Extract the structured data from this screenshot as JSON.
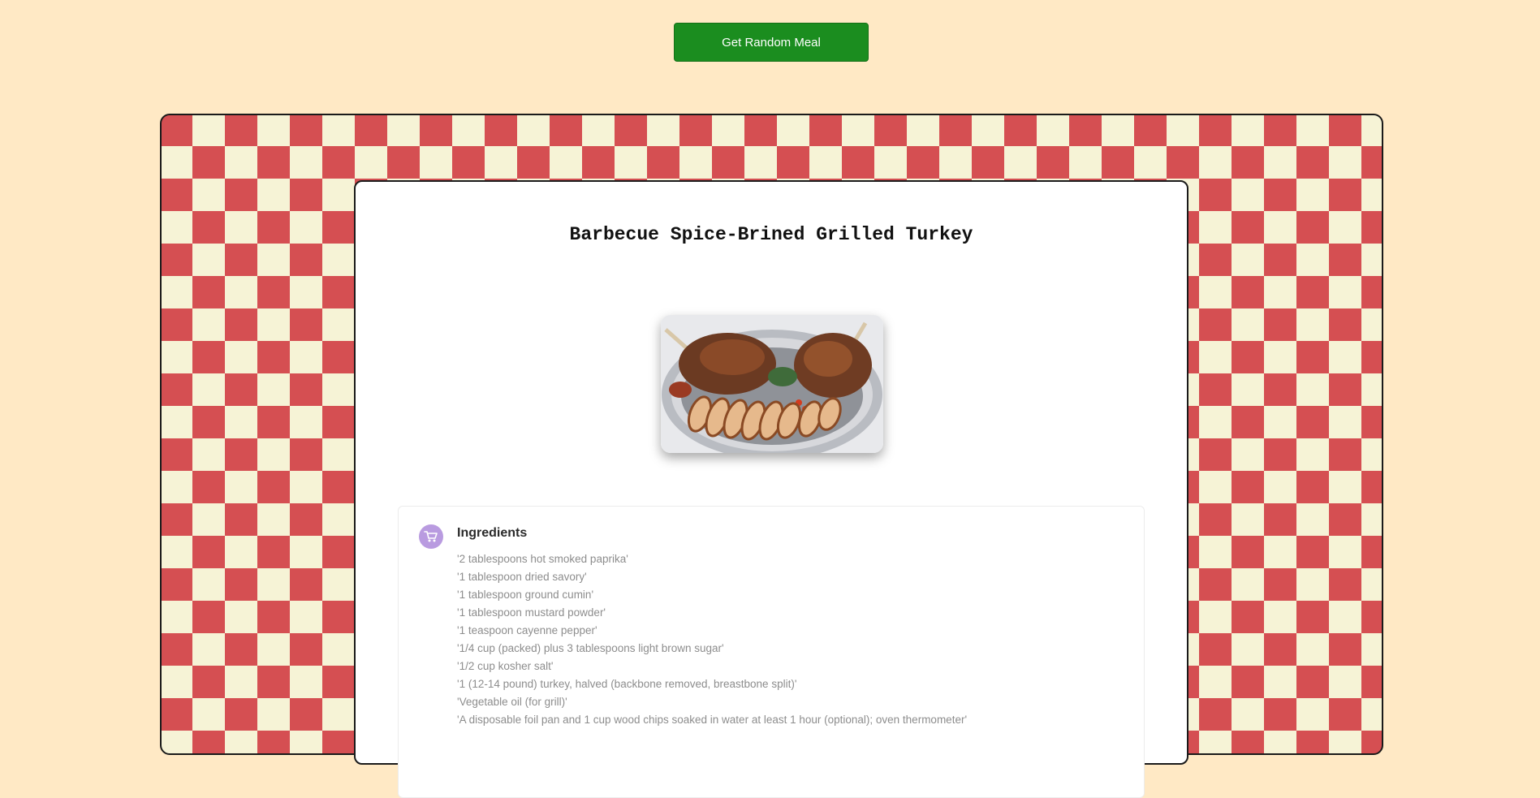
{
  "header": {
    "random_button_label": "Get Random Meal"
  },
  "meal": {
    "title": "Barbecue Spice-Brined Grilled Turkey",
    "image_alt": "grilled turkey on platter"
  },
  "ingredients": {
    "heading": "Ingredients",
    "icon": "shopping-cart-icon",
    "items": [
      "'2 tablespoons hot smoked paprika'",
      "'1 tablespoon dried savory'",
      "'1 tablespoon ground cumin'",
      "'1 tablespoon mustard powder'",
      "'1 teaspoon cayenne pepper'",
      "'1/4 cup (packed) plus 3 tablespoons light brown sugar'",
      "'1/2 cup kosher salt'",
      "'1 (12-14 pound) turkey, halved (backbone removed, breastbone split)'",
      "'Vegetable oil (for grill)'",
      "'A disposable foil pan and 1 cup wood chips soaked in water at least 1 hour (optional); oven thermometer'"
    ]
  },
  "colors": {
    "page_background": "#ffe9c5",
    "button_green": "#1b8d1f",
    "checker_red": "#d54f52",
    "checker_cream": "#f6f3d6",
    "icon_purple": "#b99be0"
  }
}
